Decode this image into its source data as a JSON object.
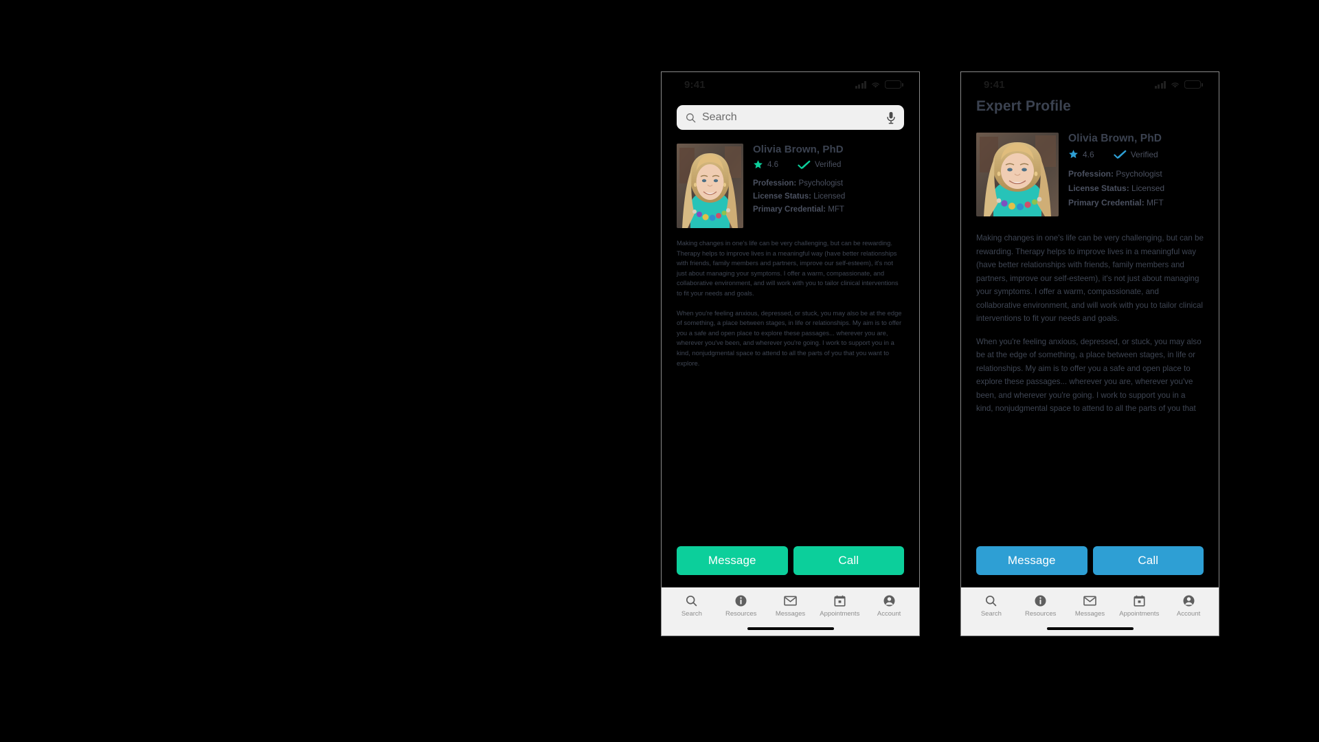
{
  "theme": {
    "background": "#000000",
    "frame_border": "#8a8a8a",
    "text_primary": "#3b4250",
    "text_body": "#3f4654",
    "accent_green": "#0ccf9b",
    "accent_blue": "#2e9fd4",
    "searchbar_bg": "#f0f0f0",
    "tabbar_bg": "#f1f1f1",
    "tab_label": "#8e8e8e"
  },
  "statusbar": {
    "time": "9:41",
    "signal_icon": "cellular-signal-icon",
    "wifi_icon": "wifi-icon",
    "battery_icon": "battery-icon"
  },
  "search": {
    "placeholder": "Search",
    "value": "",
    "search_icon": "search-icon",
    "mic_icon": "microphone-icon"
  },
  "left_screen": {
    "variant": "green-accent",
    "accent": "#0ccf9b",
    "has_search_bar": true,
    "has_page_title": false,
    "page_title": ""
  },
  "right_screen": {
    "variant": "blue-accent",
    "accent": "#2e9fd4",
    "has_search_bar": false,
    "has_page_title": true,
    "page_title": "Expert Profile"
  },
  "profile": {
    "avatar_alt": "portrait-photo-of-olivia-brown",
    "name": "Olivia Brown, PhD",
    "rating": "4.6",
    "rating_icon": "star-icon",
    "verified_label": "Verified",
    "verified_icon": "check-icon",
    "fields": [
      {
        "label": "Profession:",
        "value": " Psychologist"
      },
      {
        "label": "License Status:",
        "value": " Licensed"
      },
      {
        "label": "Primary Credential:",
        "value": " MFT"
      }
    ],
    "bio": [
      "Making changes in one's life can be very challenging, but can be rewarding. Therapy helps to improve lives in a meaningful way (have better relationships with friends, family members and partners, improve our self-esteem), it's not just about managing your symptoms. I offer a warm, compassionate, and collaborative environment, and will work with you to tailor clinical interventions to fit your needs and goals.",
      "When you're feeling anxious, depressed, or stuck, you may also be at the edge of something, a place between stages, in life or relationships. My aim is to offer you a safe and open place to explore these passages... wherever you are, wherever you've been, and wherever you're going. I work to support you in a kind, nonjudgmental space to attend to all the parts of you that you want to explore."
    ]
  },
  "actions": {
    "message_label": "Message",
    "call_label": "Call"
  },
  "tabbar": {
    "items": [
      {
        "label": "Search",
        "icon": "search-icon"
      },
      {
        "label": "Resources",
        "icon": "info-icon"
      },
      {
        "label": "Messages",
        "icon": "envelope-icon"
      },
      {
        "label": "Appointments",
        "icon": "calendar-icon"
      },
      {
        "label": "Account",
        "icon": "account-circle-icon"
      }
    ]
  }
}
